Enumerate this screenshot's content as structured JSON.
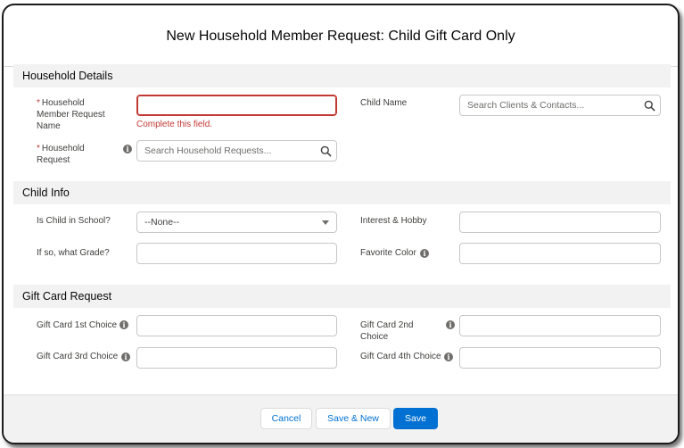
{
  "modal": {
    "title": "New Household Member Request: Child Gift Card Only"
  },
  "sections": {
    "household": {
      "header": "Household Details",
      "member_name_label": "Household Member Request Name",
      "member_name_required": "*",
      "member_name_error": "Complete this field.",
      "child_name_label": "Child Name",
      "child_name_placeholder": "Search Clients & Contacts...",
      "request_label": "Household Request",
      "request_required": "*",
      "request_placeholder": "Search Household Requests..."
    },
    "child": {
      "header": "Child Info",
      "school_label": "Is Child in School?",
      "school_value": "--None--",
      "interest_label": "Interest & Hobby",
      "grade_label": "If so, what Grade?",
      "color_label": "Favorite Color"
    },
    "giftcard": {
      "header": "Gift Card Request",
      "choice1_label": "Gift Card 1st Choice",
      "choice2_label": "Gift Card 2nd Choice",
      "choice3_label": "Gift Card 3rd Choice",
      "choice4_label": "Gift Card 4th Choice"
    }
  },
  "footer": {
    "cancel": "Cancel",
    "save_new": "Save & New",
    "save": "Save"
  },
  "icons": {
    "info": "i",
    "search": "search-icon",
    "caret": "chevron-down-icon"
  },
  "colors": {
    "brand": "#0070d2",
    "error": "#c23934",
    "section_bg": "#f3f2f2"
  }
}
